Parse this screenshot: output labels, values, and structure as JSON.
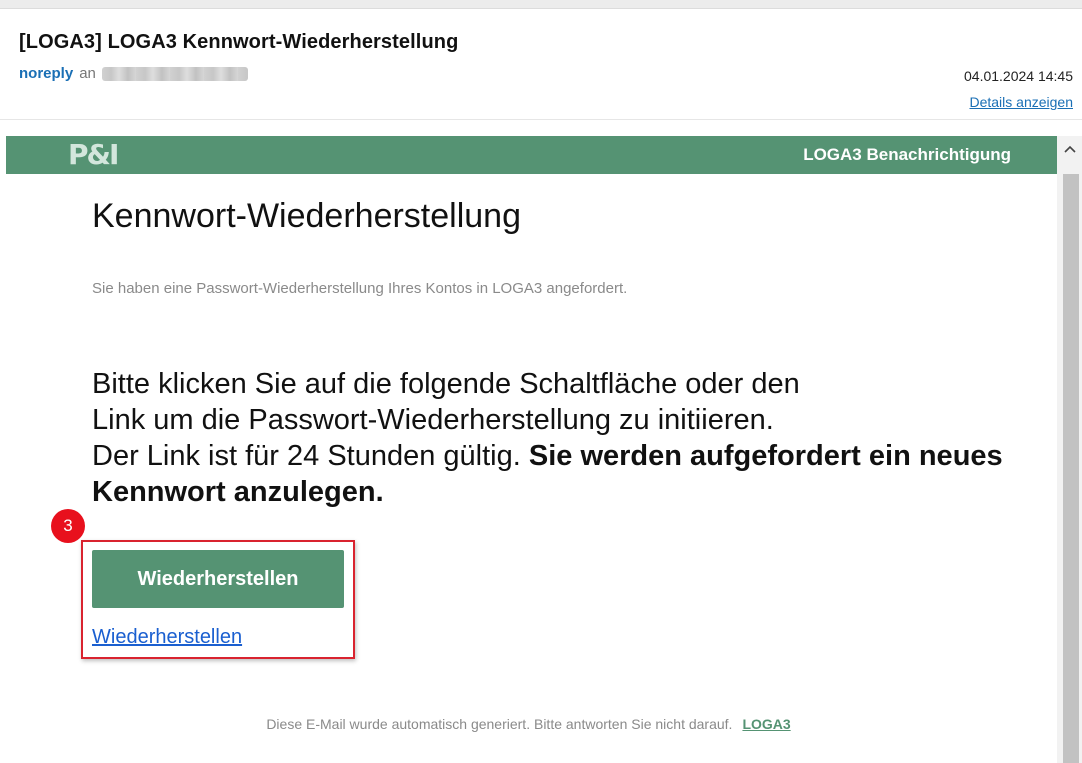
{
  "email": {
    "subject": "[LOGA3] LOGA3 Kennwort-Wiederherstellung",
    "sender": "noreply",
    "to_label": "an",
    "date": "04.01.2024 14:45",
    "details_link": "Details anzeigen"
  },
  "banner": {
    "logo_text": "P&I",
    "title": "LOGA3 Benachrichtigung",
    "color": "#559373"
  },
  "content": {
    "heading": "Kennwort-Wiederherstellung",
    "subtext": "Sie haben eine Passwort-Wiederherstellung Ihres Kontos in LOGA3 angefordert.",
    "body_line1": "Bitte klicken Sie auf die folgende Schaltfläche oder den",
    "body_line2": "Link um die Passwort-Wiederherstellung zu initiieren.",
    "body_line3": "Der Link ist für 24 Stunden gültig.",
    "body_bold": "Sie werden aufgefordert ein neues Kennwort anzulegen.",
    "button_label": "Wiederherstellen",
    "link_label": "Wiederherstellen"
  },
  "annotation": {
    "step_number": "3",
    "highlight_color": "#d9232f"
  },
  "footer": {
    "text": "Diese E-Mail wurde automatisch generiert. Bitte antworten Sie nicht darauf.",
    "link": "LOGA3"
  },
  "icons": {
    "scroll_up": "chevron-up-icon",
    "recipient": "blurred-recipient"
  }
}
